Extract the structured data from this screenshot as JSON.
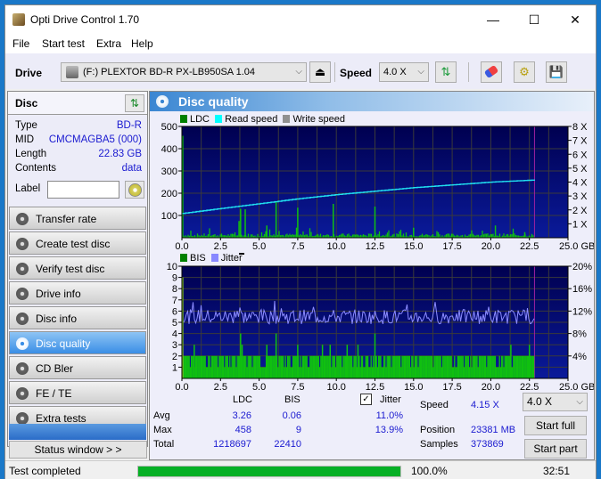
{
  "window": {
    "title": "Opti Drive Control 1.70",
    "minimize": "—",
    "maximize": "☐",
    "close": "✕"
  },
  "menu": [
    "File",
    "Start test",
    "Extra",
    "Help"
  ],
  "toolbar": {
    "drive_label": "Drive",
    "drive_value": "(F:)  PLEXTOR BD-R  PX-LB950SA 1.04",
    "speed_label": "Speed",
    "speed_value": "4.0 X",
    "icons": [
      "eject-icon",
      "refresh-icon",
      "erase-icon",
      "settings-icon",
      "save-icon"
    ]
  },
  "disc": {
    "header": "Disc",
    "type_label": "Type",
    "type": "BD-R",
    "mid_label": "MID",
    "mid": "CMCMAGBA5 (000)",
    "length_label": "Length",
    "length": "22.83 GB",
    "contents_label": "Contents",
    "contents": "data",
    "label_label": "Label",
    "label_value": ""
  },
  "nav": [
    {
      "label": "Transfer rate",
      "active": false
    },
    {
      "label": "Create test disc",
      "active": false
    },
    {
      "label": "Verify test disc",
      "active": false
    },
    {
      "label": "Drive info",
      "active": false
    },
    {
      "label": "Disc info",
      "active": false
    },
    {
      "label": "Disc quality",
      "active": true
    },
    {
      "label": "CD Bler",
      "active": false
    },
    {
      "label": "FE / TE",
      "active": false
    },
    {
      "label": "Extra tests",
      "active": false
    }
  ],
  "status_window_button": "Status window > >",
  "panel_title": "Disc quality",
  "chart_data": [
    {
      "type": "bar",
      "title": "LDC / Read speed",
      "legend": [
        "LDC",
        "Read speed",
        "Write speed"
      ],
      "legend_colors": [
        "#008000",
        "#00ffff",
        "#909090"
      ],
      "xlabel": "GB",
      "x_ticks": [
        "0.0",
        "2.5",
        "5.0",
        "7.5",
        "10.0",
        "12.5",
        "15.0",
        "17.5",
        "20.0",
        "22.5",
        "25.0 GB"
      ],
      "xlim": [
        0,
        25
      ],
      "y_ticks": [
        "100",
        "200",
        "300",
        "400",
        "500"
      ],
      "ylim": [
        0,
        500
      ],
      "y2_ticks": [
        "1 X",
        "2 X",
        "3 X",
        "4 X",
        "5 X",
        "6 X",
        "7 X",
        "8 X"
      ],
      "y2lim": [
        0,
        8
      ],
      "disc_end_gb": 22.83,
      "ldc_spikes": [
        [
          0.05,
          458
        ],
        [
          3.7,
          75
        ],
        [
          3.8,
          130
        ],
        [
          4.1,
          128
        ],
        [
          5.5,
          55
        ],
        [
          6.1,
          160
        ],
        [
          7.5,
          135
        ],
        [
          9.8,
          152
        ],
        [
          12.5,
          140
        ],
        [
          15.0,
          45
        ],
        [
          20.3,
          55
        ],
        [
          22.2,
          25
        ]
      ],
      "ldc_baseline": 12,
      "read_speed": [
        [
          0,
          1.75
        ],
        [
          2.5,
          2.1
        ],
        [
          5,
          2.45
        ],
        [
          7.5,
          2.8
        ],
        [
          10,
          3.1
        ],
        [
          12.5,
          3.35
        ],
        [
          15,
          3.6
        ],
        [
          17.5,
          3.8
        ],
        [
          20,
          4.0
        ],
        [
          22.83,
          4.15
        ]
      ]
    },
    {
      "type": "bar",
      "title": "BIS / Jitter",
      "legend": [
        "BIS",
        "Jitter"
      ],
      "legend_colors": [
        "#008000",
        "#8888ff"
      ],
      "xlabel": "GB",
      "x_ticks": [
        "0.0",
        "2.5",
        "5.0",
        "7.5",
        "10.0",
        "12.5",
        "15.0",
        "17.5",
        "20.0",
        "22.5",
        "25.0 GB"
      ],
      "xlim": [
        0,
        25
      ],
      "y_ticks": [
        "1",
        "2",
        "3",
        "4",
        "5",
        "6",
        "7",
        "8",
        "9",
        "10"
      ],
      "ylim": [
        0,
        10
      ],
      "y2_ticks": [
        "4%",
        "8%",
        "12%",
        "16%",
        "20%"
      ],
      "y2lim": [
        0,
        20
      ],
      "disc_end_gb": 22.83,
      "bis_spikes": [
        [
          0.05,
          9
        ],
        [
          3.8,
          4
        ],
        [
          6.1,
          4
        ],
        [
          12.5,
          4
        ],
        [
          0.8,
          3
        ],
        [
          3.9,
          3
        ],
        [
          5.5,
          3
        ],
        [
          7.5,
          3
        ],
        [
          9.1,
          3
        ],
        [
          9.6,
          3
        ],
        [
          10.7,
          3
        ],
        [
          11.4,
          3
        ],
        [
          21.3,
          3
        ],
        [
          22.5,
          3
        ]
      ],
      "jitter_avg_percent": 11.0,
      "jitter_max_percent": 13.9
    }
  ],
  "stats": {
    "col_ldc": "LDC",
    "col_bis": "BIS",
    "jitter_label": "Jitter",
    "jitter_checked": true,
    "rows": [
      {
        "label": "Avg",
        "ldc": "3.26",
        "bis": "0.06",
        "jitter": "11.0%"
      },
      {
        "label": "Max",
        "ldc": "458",
        "bis": "9",
        "jitter": "13.9%"
      },
      {
        "label": "Total",
        "ldc": "1218697",
        "bis": "22410",
        "jitter": ""
      }
    ],
    "speed_label": "Speed",
    "speed_value": "4.15 X",
    "position_label": "Position",
    "position_value": "23381 MB",
    "samples_label": "Samples",
    "samples_value": "373869",
    "speed_select": "4.0 X",
    "start_full": "Start full",
    "start_part": "Start part"
  },
  "status": {
    "text": "Test completed",
    "progress_percent": 100.0,
    "progress_label": "100.0%",
    "time": "32:51"
  }
}
